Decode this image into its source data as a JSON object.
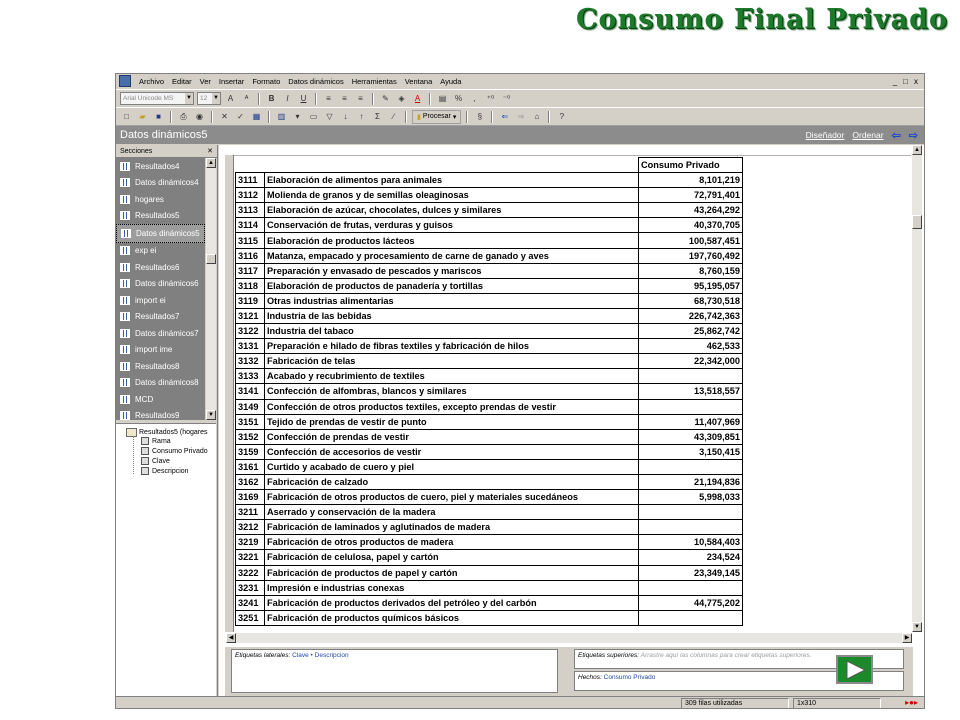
{
  "slide_title": "Consumo Final Privado",
  "menu": [
    "Archivo",
    "Editar",
    "Ver",
    "Insertar",
    "Formato",
    "Datos dinámicos",
    "Herramientas",
    "Ventana",
    "Ayuda"
  ],
  "window_controls": [
    "_",
    "□",
    "x"
  ],
  "toolbar": {
    "font_name": "Arial Unicode MS",
    "font_size": "12",
    "percent_symbol": "%",
    "procesar_label": "Procesar"
  },
  "header": {
    "title": "Datos dinámicos5",
    "link_designer": "Diseñador",
    "link_order": "Ordenar"
  },
  "sidebar": {
    "sections_label": "Secciones",
    "close": "✕",
    "items": [
      "Resultados4",
      "Datos dinámicos4",
      "hogares",
      "Resultados5",
      "Datos dinámicos5",
      "exp ei",
      "Resultados6",
      "Datos dinámicos6",
      "import ei",
      "Resultados7",
      "Datos dinámicos7",
      "import ime",
      "Resultados8",
      "Datos dinámicos8",
      "MCD",
      "Resultados9"
    ],
    "selected_item": "Datos dinámicos5"
  },
  "tree": {
    "root": "Resultados5 (hogares",
    "children": [
      "Rama",
      "Consumo Privado",
      "Clave",
      "Descripcion"
    ]
  },
  "table": {
    "column_header": "Consumo Privado",
    "rows": [
      {
        "code": "3111",
        "desc": "Elaboración de alimentos para animales",
        "value": "8,101,219"
      },
      {
        "code": "3112",
        "desc": "Molienda de granos y de semillas oleaginosas",
        "value": "72,791,401"
      },
      {
        "code": "3113",
        "desc": "Elaboración de azúcar, chocolates, dulces y similares",
        "value": "43,264,292"
      },
      {
        "code": "3114",
        "desc": "Conservación de frutas, verduras y guisos",
        "value": "40,370,705"
      },
      {
        "code": "3115",
        "desc": "Elaboración de productos lácteos",
        "value": "100,587,451"
      },
      {
        "code": "3116",
        "desc": "Matanza, empacado y procesamiento de carne de ganado y aves",
        "value": "197,760,492"
      },
      {
        "code": "3117",
        "desc": "Preparación y envasado de pescados y mariscos",
        "value": "8,760,159"
      },
      {
        "code": "3118",
        "desc": "Elaboración de productos de panadería y tortillas",
        "value": "95,195,057"
      },
      {
        "code": "3119",
        "desc": "Otras industrias alimentarias",
        "value": "68,730,518"
      },
      {
        "code": "3121",
        "desc": "Industria de las bebidas",
        "value": "226,742,363"
      },
      {
        "code": "3122",
        "desc": "Industria del tabaco",
        "value": "25,862,742"
      },
      {
        "code": "3131",
        "desc": "Preparación e hilado de fibras textiles y fabricación de hilos",
        "value": "462,533"
      },
      {
        "code": "3132",
        "desc": "Fabricación de telas",
        "value": "22,342,000"
      },
      {
        "code": "3133",
        "desc": "Acabado y recubrimiento de textiles",
        "value": ""
      },
      {
        "code": "3141",
        "desc": "Confección de alfombras, blancos y similares",
        "value": "13,518,557"
      },
      {
        "code": "3149",
        "desc": "Confección de otros productos textiles, excepto prendas de vestir",
        "value": ""
      },
      {
        "code": "3151",
        "desc": "Tejido de prendas de vestir de punto",
        "value": "11,407,969"
      },
      {
        "code": "3152",
        "desc": "Confección de prendas de vestir",
        "value": "43,309,851"
      },
      {
        "code": "3159",
        "desc": "Confección de accesorios de vestir",
        "value": "3,150,415"
      },
      {
        "code": "3161",
        "desc": "Curtido y acabado de cuero y piel",
        "value": ""
      },
      {
        "code": "3162",
        "desc": "Fabricación de calzado",
        "value": "21,194,836"
      },
      {
        "code": "3169",
        "desc": "Fabricación de otros productos de cuero, piel y materiales sucedáneos",
        "value": "5,998,033"
      },
      {
        "code": "3211",
        "desc": "Aserrado y conservación de la madera",
        "value": ""
      },
      {
        "code": "3212",
        "desc": "Fabricación de laminados y aglutinados de madera",
        "value": ""
      },
      {
        "code": "3219",
        "desc": "Fabricación de otros productos de madera",
        "value": "10,584,403"
      },
      {
        "code": "3221",
        "desc": "Fabricación de celulosa, papel y cartón",
        "value": "234,524"
      },
      {
        "code": "3222",
        "desc": "Fabricación de productos de papel y cartón",
        "value": "23,349,145"
      },
      {
        "code": "3231",
        "desc": "Impresión e industrias conexas",
        "value": ""
      },
      {
        "code": "3241",
        "desc": "Fabricación de productos derivados del petróleo y del carbón",
        "value": "44,775,202"
      },
      {
        "code": "3251",
        "desc": "Fabricación de productos químicos básicos",
        "value": ""
      }
    ]
  },
  "labels": {
    "side_label": "Etiquetas laterales:",
    "side_value_1": "Clave",
    "side_value_2": "Descripcion",
    "top_label": "Etiquetas superiores:",
    "top_hint": "Arrastre aquí las columnas para crear etiquetas superiores.",
    "facts_label": "Hechos:",
    "facts_value": "Consumo Privado"
  },
  "status": {
    "rows_used": "309 filas utilizadas",
    "cell_ref": "1x310"
  },
  "colors": {
    "title_green": "#1c7a2a",
    "play_green": "#1b8a2b",
    "link_blue": "#2248a8"
  }
}
